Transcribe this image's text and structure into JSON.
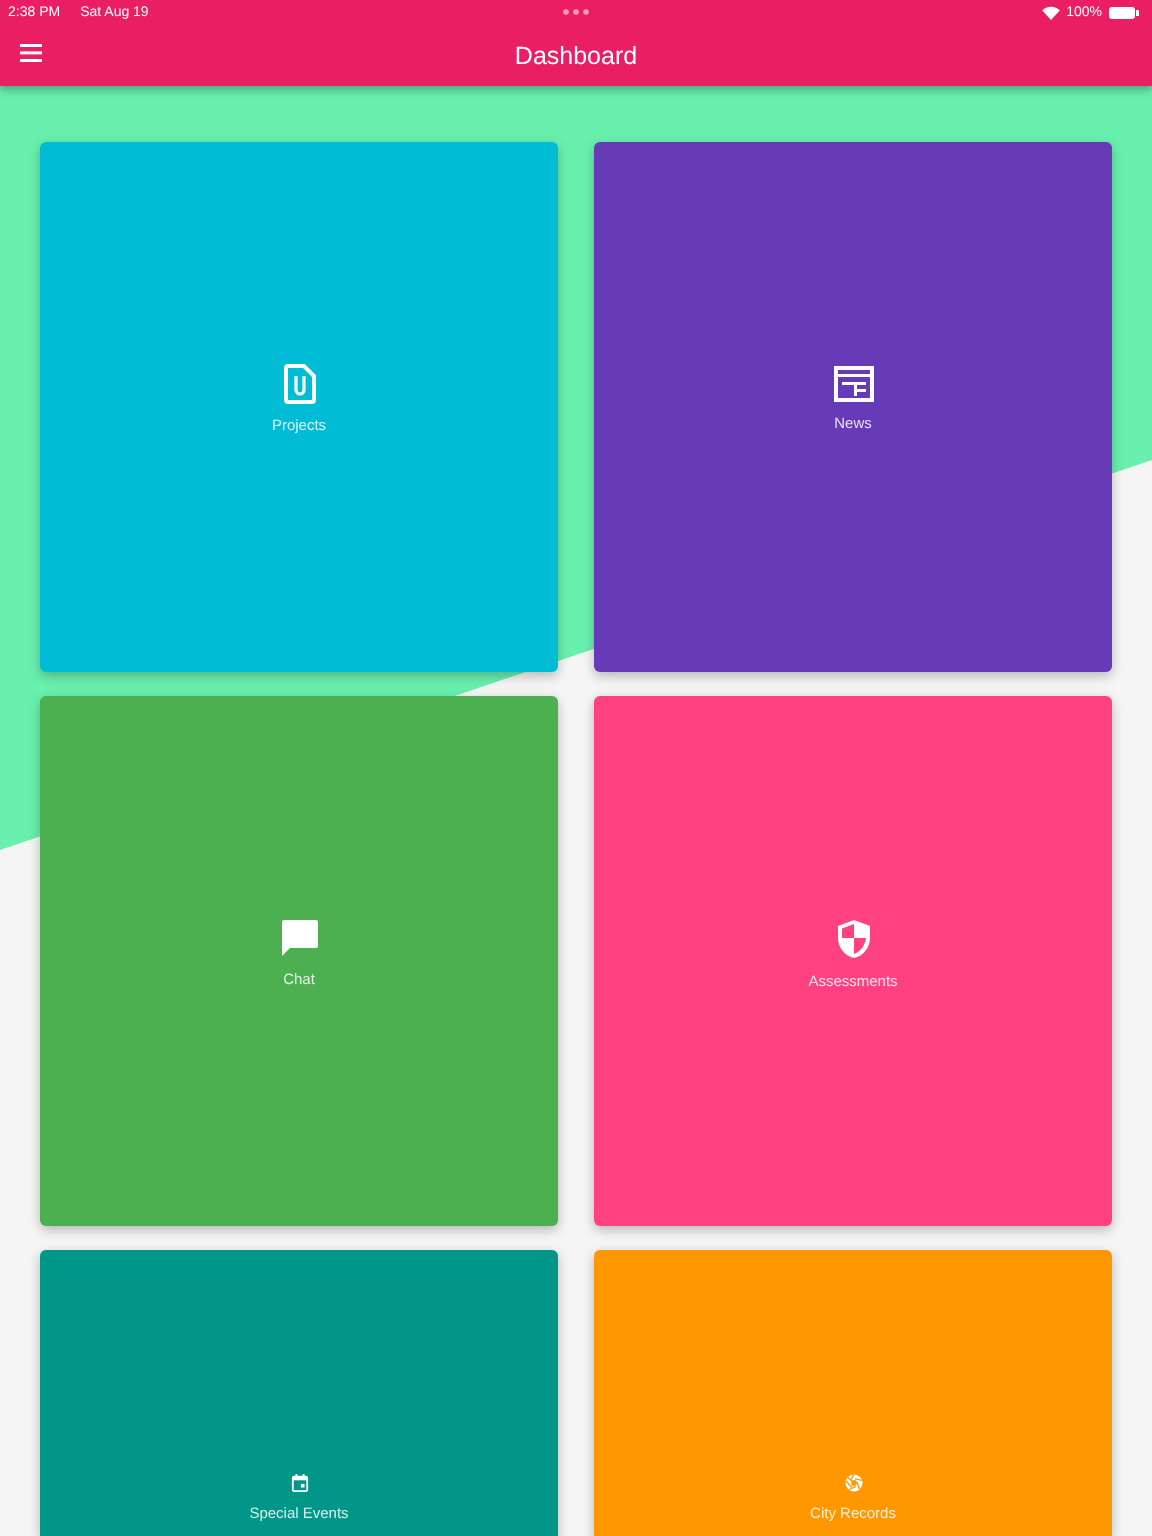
{
  "status_bar": {
    "time": "2:38 PM",
    "date": "Sat Aug 19",
    "battery": "100%"
  },
  "app_bar": {
    "title": "Dashboard"
  },
  "tiles": [
    {
      "label": "Projects",
      "color": "#00bcd4",
      "kind": "file"
    },
    {
      "label": "News",
      "color": "#673ab7",
      "kind": "news"
    },
    {
      "label": "Chat",
      "color": "#4caf50",
      "kind": "chat"
    },
    {
      "label": "Assessments",
      "color": "#ff4081",
      "kind": "shield"
    },
    {
      "label": "Special Events",
      "color": "#009688",
      "kind": "calendar"
    },
    {
      "label": "City Records",
      "color": "#ff9800",
      "kind": "aperture"
    }
  ]
}
